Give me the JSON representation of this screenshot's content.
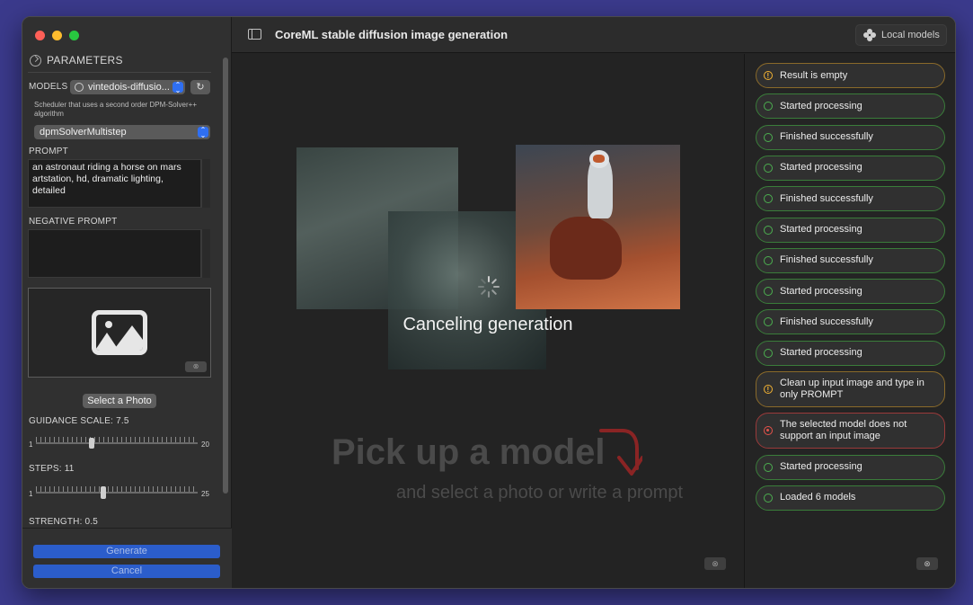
{
  "sidebar": {
    "section_title": "PARAMETERS",
    "models_label": "MODELS",
    "model_selected": "vintedois-diffusio...",
    "scheduler_desc": "Scheduler that uses a second order DPM-Solver++ algorithm",
    "scheduler_selected": "dpmSolverMultistep",
    "prompt_label": "PROMPT",
    "prompt_value": "an astronaut riding a horse on mars artstation, hd, dramatic lighting, detailed",
    "negative_label": "NEGATIVE PROMPT",
    "negative_value": "",
    "select_photo": "Select a Photo",
    "guidance_label": "GUIDANCE SCALE: 7.5",
    "guidance_min": "1",
    "guidance_max": "20",
    "guidance_value": 7.5,
    "steps_label": "STEPS: 11",
    "steps_min": "1",
    "steps_max": "25",
    "steps_value": 11,
    "strength_label": "STRENGTH: 0.5",
    "generate": "Generate",
    "cancel": "Cancel"
  },
  "toolbar": {
    "title": "CoreML stable diffusion image generation",
    "local_models": "Local models"
  },
  "canvas": {
    "status": "Canceling generation",
    "headline": "Pick up a model",
    "subline": "and select a photo or write a prompt"
  },
  "log": {
    "items": [
      {
        "text": "Result is empty",
        "status": "warn"
      },
      {
        "text": "Started processing",
        "status": "ok"
      },
      {
        "text": "Finished successfully",
        "status": "ok"
      },
      {
        "text": "Started processing",
        "status": "ok"
      },
      {
        "text": "Finished successfully",
        "status": "ok"
      },
      {
        "text": "Started processing",
        "status": "ok"
      },
      {
        "text": "Finished successfully",
        "status": "ok"
      },
      {
        "text": "Started processing",
        "status": "ok"
      },
      {
        "text": "Finished successfully",
        "status": "ok"
      },
      {
        "text": "Started processing",
        "status": "ok"
      },
      {
        "text": "Clean up input image and type in only PROMPT",
        "status": "warn"
      },
      {
        "text": "The selected model does not support an input image",
        "status": "err"
      },
      {
        "text": "Started processing",
        "status": "ok"
      },
      {
        "text": "Loaded 6 models",
        "status": "ok"
      }
    ]
  },
  "colors": {
    "accent": "#2f6ff2",
    "ok": "#4caf50",
    "warn": "#f2b233",
    "err": "#e5534b"
  }
}
